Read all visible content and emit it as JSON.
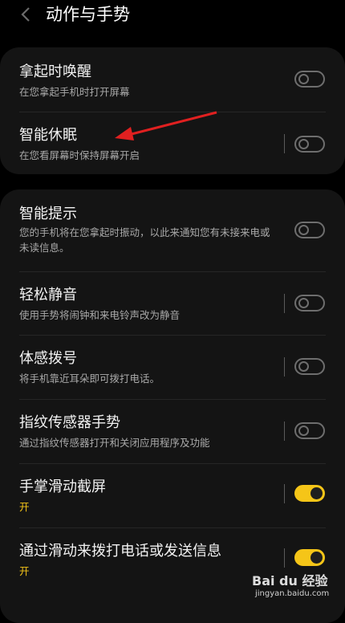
{
  "header": {
    "title": "动作与手势",
    "back_icon": "chevron-left-icon"
  },
  "groups": [
    {
      "items": [
        {
          "title": "拿起时唤醒",
          "subtitle": "在您拿起手机时打开屏幕",
          "state": "off"
        },
        {
          "title": "智能休眠",
          "subtitle": "在您看屏幕时保持屏幕开启",
          "state": "off"
        }
      ]
    },
    {
      "items": [
        {
          "title": "智能提示",
          "subtitle": "您的手机将在您拿起时振动，以此来通知您有未接来电或未读信息。",
          "state": "off"
        },
        {
          "title": "轻松静音",
          "subtitle": "使用手势将闹钟和来电铃声改为静音",
          "state": "off"
        },
        {
          "title": "体感拨号",
          "subtitle": "将手机靠近耳朵即可拨打电话。",
          "state": "off"
        },
        {
          "title": "指纹传感器手势",
          "subtitle": "通过指纹传感器打开和关闭应用程序及功能",
          "state": "off"
        },
        {
          "title": "手掌滑动截屏",
          "subtitle": "开",
          "state": "on"
        },
        {
          "title": "通过滑动来拨打电话或发送信息",
          "subtitle": "开",
          "state": "on"
        }
      ]
    }
  ],
  "watermark": {
    "brand": "Bai du 经验",
    "url": "jingyan.baidu.com"
  },
  "colors": {
    "accent": "#f5c518",
    "annotation_arrow": "#e02020",
    "card_bg": "#141414"
  }
}
